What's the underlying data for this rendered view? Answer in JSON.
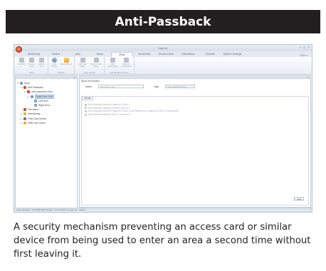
{
  "header": {
    "title": "Anti-Passback"
  },
  "window": {
    "title": "Ingress"
  },
  "tabs": [
    "Monitoring",
    "Device",
    "User",
    "Doors",
    "Zone",
    "Visual Map",
    "Access Level",
    "Attendance",
    "Reports",
    "System Settings"
  ],
  "active_tab": "Zone",
  "style_menu": "Style",
  "ribbon": {
    "groups": [
      {
        "label": "Zone",
        "buttons": [
          {
            "label": "Add Zone",
            "icon": "gray"
          },
          {
            "label": "Rename Zone",
            "icon": "gray"
          },
          {
            "label": "Remove Zone",
            "icon": "gray"
          }
        ]
      },
      {
        "label": "Device",
        "buttons": [
          {
            "label": "Add Device",
            "icon": "blue"
          },
          {
            "label": "Delete Device",
            "icon": "orange"
          }
        ]
      },
      {
        "label": "User Group",
        "buttons": [
          {
            "label": "Add User Group",
            "icon": "gray"
          },
          {
            "label": "Remove User Group",
            "icon": "gray"
          }
        ]
      },
      {
        "label": "Combination Group",
        "buttons": [
          {
            "label": "Add Combination",
            "icon": "gray"
          },
          {
            "label": "Remove Combination",
            "icon": "gray"
          }
        ]
      }
    ]
  },
  "tree": [
    {
      "label": "Zone",
      "level": 0,
      "arrow": "▾",
      "icon": "blue"
    },
    {
      "label": "Anti Passback",
      "level": 1,
      "arrow": "▾",
      "icon": "red"
    },
    {
      "label": "Anti-passback Zone",
      "level": 2,
      "arrow": "▾",
      "icon": "red"
    },
    {
      "label": "Main Door Unit",
      "level": 3,
      "arrow": "▾",
      "icon": "blue",
      "selected": true
    },
    {
      "label": "Left Door",
      "level": 4,
      "arrow": "",
      "icon": "door"
    },
    {
      "label": "Right Door",
      "level": 4,
      "arrow": "",
      "icon": "door"
    },
    {
      "label": "Fire Alarm",
      "level": 1,
      "arrow": "",
      "icon": "red"
    },
    {
      "label": "Interlocking",
      "level": 1,
      "arrow": "▸",
      "icon": "yellow"
    },
    {
      "label": "First Card Unlock",
      "level": 1,
      "arrow": "▸",
      "icon": "purple"
    },
    {
      "label": "Multi Card Open",
      "level": 1,
      "arrow": "▸",
      "icon": "yellow"
    }
  ],
  "basic_info": {
    "section_title": "Basic Information",
    "name_label": "Name",
    "name_value": "Main Door Unit",
    "type_label": "Type",
    "type_value": "Anti-passback Zone"
  },
  "details": {
    "tab_label": "Details",
    "options": [
      {
        "label": "Anti-Passback between readers of Door 1",
        "checked": true
      },
      {
        "label": "Anti-Passback between readers of Door 2",
        "checked": false
      },
      {
        "label": "Anti-Passback between readers of Door 1 and between the readers of Door 2 respectively",
        "checked": false
      },
      {
        "label": "Anti-Passback between Door 1 and Door 2",
        "checked": false
      }
    ],
    "add_button": "Add"
  },
  "statusbar": {
    "text": "Login Duration : 01:00:25    SDK Version : 6.2.3.6.3877-1    Login As : admin"
  },
  "caption": "A security mechanism preventing an access card or similar device from being used to enter an area a second time without first leaving it."
}
